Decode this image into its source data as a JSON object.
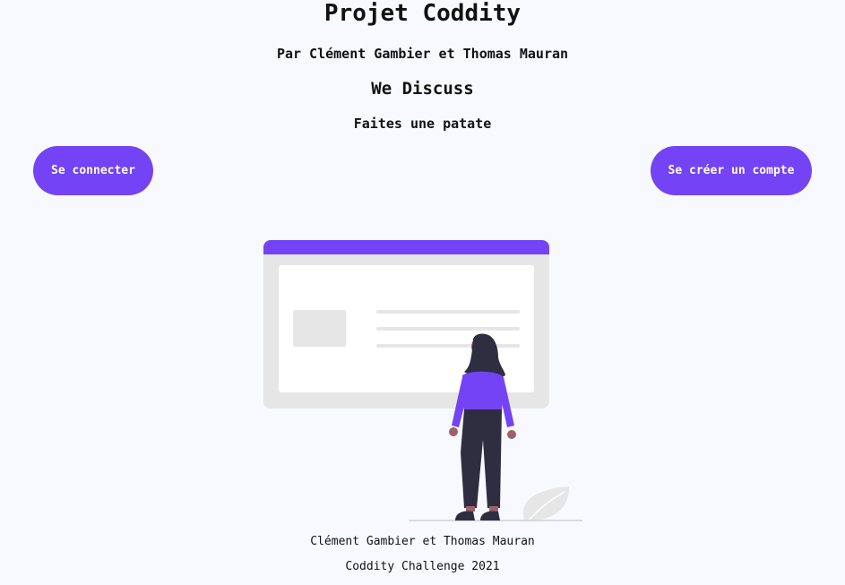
{
  "header": {
    "title": "Projet Coddity",
    "subtitle": "Par Clément Gambier et Thomas Mauran",
    "heading": "We Discuss",
    "tagline": "Faites une patate"
  },
  "actions": {
    "login_label": "Se connecter",
    "signup_label": "Se créer un compte"
  },
  "illustration": {
    "icon": "person-viewing-webpage-illustration",
    "accent_color": "#7343f5"
  },
  "footer": {
    "names": "Clément Gambier et Thomas Mauran",
    "event": "Coddity Challenge 2021"
  },
  "colors": {
    "background": "#f8f9fe",
    "accent": "#7343f5",
    "button_text": "#ffffff"
  }
}
